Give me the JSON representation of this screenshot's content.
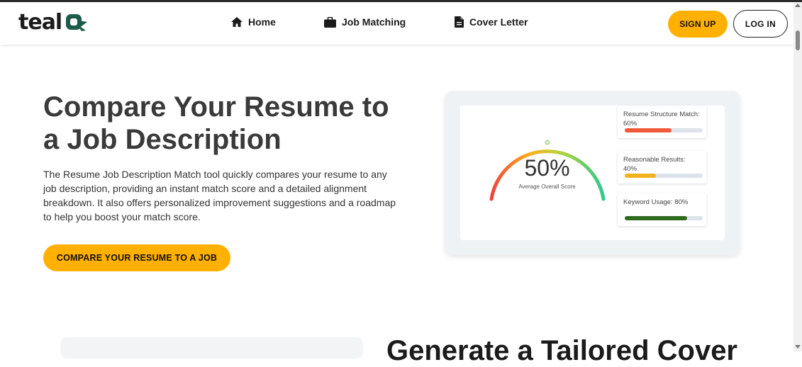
{
  "header": {
    "logo_text": "teal",
    "nav": [
      {
        "label": "Home",
        "icon": "home-icon"
      },
      {
        "label": "Job Matching",
        "icon": "briefcase-icon"
      },
      {
        "label": "Cover Letter",
        "icon": "document-icon"
      }
    ],
    "signup_label": "SIGN UP",
    "login_label": "LOG IN"
  },
  "hero": {
    "title": "Compare Your Resume to a Job Description",
    "description": "The Resume Job Description Match tool quickly compares your resume to any job description, providing an instant match score and a detailed alignment breakdown. It also offers personalized improvement suggestions and a roadmap to help you boost your match score.",
    "cta_label": "COMPARE YOUR RESUME TO A JOB"
  },
  "score_card": {
    "score": "50%",
    "score_label": "Average Overall Score",
    "metrics": [
      {
        "label": "Resume Structure Match: 60%",
        "value": 0.6,
        "color": "#f05a3c"
      },
      {
        "label": "Reasonable Results: 40%",
        "value": 0.4,
        "color": "#f2b21b"
      },
      {
        "label": "Keyword Usage: 80%",
        "value": 0.8,
        "color": "#2f6b1e"
      }
    ]
  },
  "section2": {
    "title": "Generate a Tailored Cover"
  },
  "colors": {
    "accent": "#ffb000",
    "text_dark": "#3a3a3a"
  }
}
